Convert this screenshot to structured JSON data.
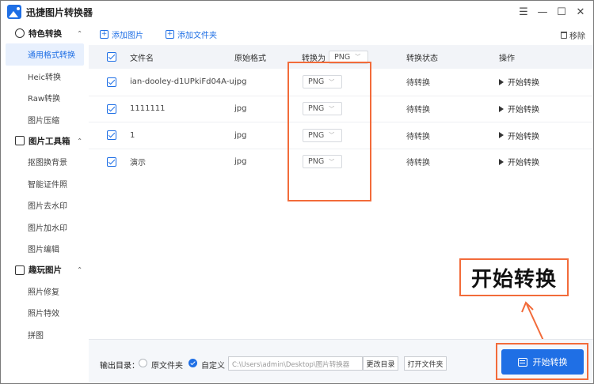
{
  "app": {
    "title": "迅捷图片转换器",
    "window_controls": {
      "menu": "☰",
      "minimize": "—",
      "maximize": "☐",
      "close": "✕"
    }
  },
  "sidebar": {
    "groups": [
      {
        "title": "特色转换",
        "items": [
          "通用格式转换",
          "Heic转换",
          "Raw转换",
          "图片压缩"
        ]
      },
      {
        "title": "图片工具箱",
        "items": [
          "抠图换背景",
          "智能证件照",
          "图片去水印",
          "图片加水印",
          "图片编辑"
        ]
      },
      {
        "title": "趣玩图片",
        "items": [
          "照片修复",
          "照片特效",
          "拼图"
        ]
      }
    ],
    "active_item": "通用格式转换"
  },
  "toolbar": {
    "add_image": "添加图片",
    "add_folder": "添加文件夹",
    "remove": "移除"
  },
  "table": {
    "headers": {
      "name": "文件名",
      "format": "原始格式",
      "convert_to": "转换为",
      "status": "转换状态",
      "action": "操作"
    },
    "header_select": "PNG",
    "rows": [
      {
        "name": "ian-dooley-d1UPkiFd04A-un...",
        "format": "jpg",
        "target": "PNG",
        "status": "待转换",
        "action": "开始转换"
      },
      {
        "name": "1111111",
        "format": "jpg",
        "target": "PNG",
        "status": "待转换",
        "action": "开始转换"
      },
      {
        "name": "1",
        "format": "jpg",
        "target": "PNG",
        "status": "待转换",
        "action": "开始转换"
      },
      {
        "name": "演示",
        "format": "jpg",
        "target": "PNG",
        "status": "待转换",
        "action": "开始转换"
      }
    ]
  },
  "bottom": {
    "output_label": "输出目录：",
    "radio_original": "原文件夹",
    "radio_custom": "自定义",
    "path": "C:\\Users\\admin\\Desktop\\图片转换器",
    "change_dir": "更改目录",
    "open_folder": "打开文件夹",
    "start": "开始转换"
  },
  "callout": {
    "text": "开始转换"
  },
  "colors": {
    "accent": "#1f6fe5",
    "highlight": "#f26b3a"
  }
}
